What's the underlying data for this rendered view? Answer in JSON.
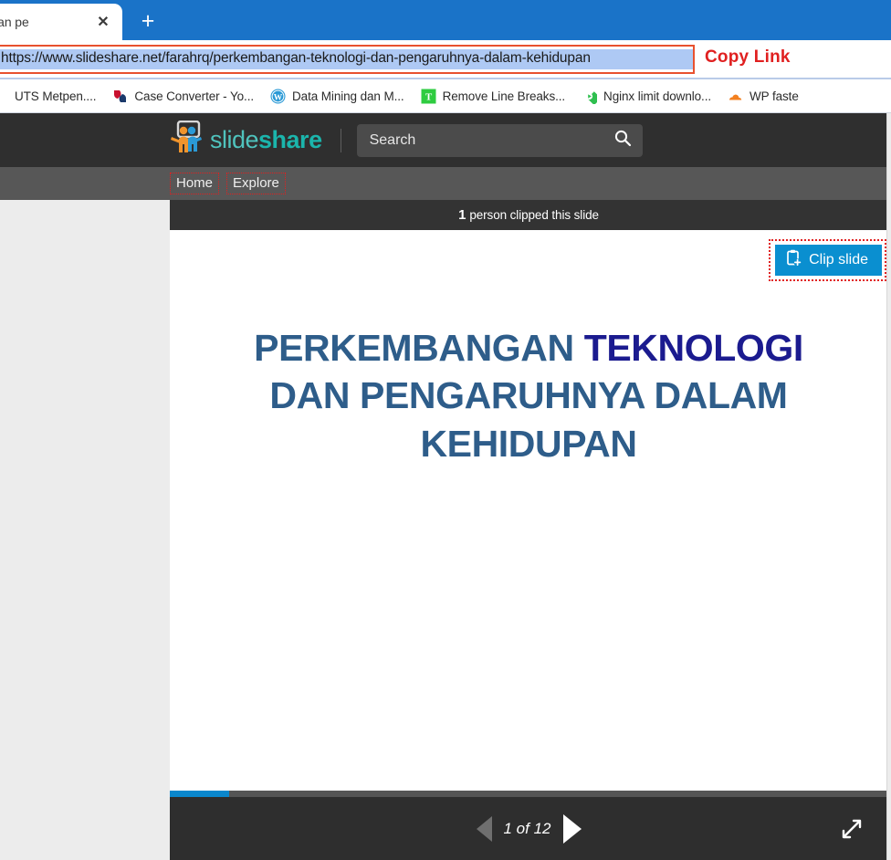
{
  "browser": {
    "tab": {
      "title": "knologi dan pe",
      "close_icon": "close-icon"
    },
    "new_tab_icon": "plus-icon",
    "url": "https://www.slideshare.net/farahrq/perkembangan-teknologi-dan-pengaruhnya-dalam-kehidupan",
    "annotation_copy_link": "Copy Link",
    "bookmarks": [
      {
        "label": "UTS Metpen....",
        "icon": "bookmark-icon"
      },
      {
        "label": "Case Converter - Yo...",
        "icon": "case-converter-icon"
      },
      {
        "label": "Data Mining dan M...",
        "icon": "wordpress-icon"
      },
      {
        "label": "Remove Line Breaks...",
        "icon": "textfixer-icon"
      },
      {
        "label": "Nginx limit downlo...",
        "icon": "play-diamond-icon"
      },
      {
        "label": "WP faste",
        "icon": "cloudflare-icon"
      }
    ]
  },
  "site": {
    "logo": {
      "light": "slide",
      "bold": "share",
      "icon": "slideshare-logo-icon"
    },
    "search": {
      "placeholder": "Search",
      "value": "Search",
      "icon": "search-icon"
    },
    "nav": [
      {
        "label": "Home"
      },
      {
        "label": "Explore"
      }
    ]
  },
  "viewer": {
    "clip_banner": {
      "count": "1",
      "text": "person clipped this slide"
    },
    "clip_slide_button": {
      "label": "Clip slide",
      "icon": "clipboard-plus-icon",
      "color": "#0a8fd0"
    },
    "slide": {
      "line1_a": "PERKEMBANGAN ",
      "line1_b": "TEKNOLOGI",
      "line2": "DAN PENGARUHNYA DALAM",
      "line3": "KEHIDUPAN",
      "color_primary": "#2e5d8a",
      "color_accent": "#1b1b8f"
    },
    "footer": {
      "prev_icon": "triangle-left-icon",
      "next_icon": "triangle-right-icon",
      "page_indicator": "1 of 12",
      "fullscreen_icon": "expand-arrows-icon",
      "progress_percent": 8.33
    }
  }
}
